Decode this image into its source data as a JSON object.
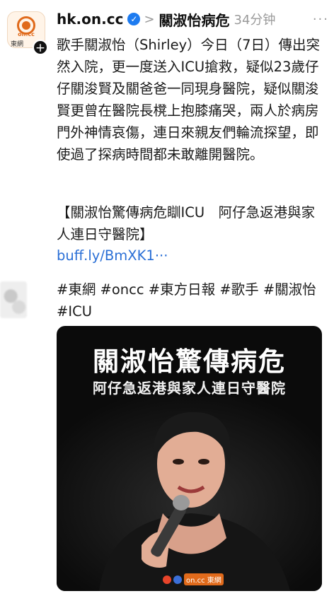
{
  "post": {
    "account_avatar_label": "on.cc",
    "account_avatar_tag": "東網",
    "account_name": "hk.on.cc",
    "topic": "關淑怡病危",
    "time": "34分钟",
    "more": "···",
    "body": "歌手關淑怡（Shirley）今日（7日）傳出突然入院，更一度送入ICU搶救，疑似23歲仔仔關浚賢及關爸爸一同現身醫院，疑似關浚賢更曾在醫院長櫈上抱膝痛哭，兩人於病房門外神情哀傷，連日來親友們輪流探望，即使過了探病時間都未敢離開醫院。",
    "headline": "【關淑怡驚傳病危瞓ICU　阿仔急返港與家人連日守醫院】",
    "link": "buff.ly/BmXK1···",
    "hashtags": "#東網 #oncc #東方日報 #歌手 #關淑怡 #ICU"
  },
  "image": {
    "title": "關淑怡驚傳病危",
    "subtitle": "阿仔急返港與家人連日守醫院",
    "watermark": "on.cc 東網"
  },
  "icons": {
    "follow": "plus-icon",
    "verified": "verified-check-icon",
    "chevron": "chevron-right-icon",
    "more": "more-horizontal-icon"
  },
  "colors": {
    "link": "#2a6fd6",
    "verified": "#1d7bf0",
    "brand": "#e06a1b"
  }
}
